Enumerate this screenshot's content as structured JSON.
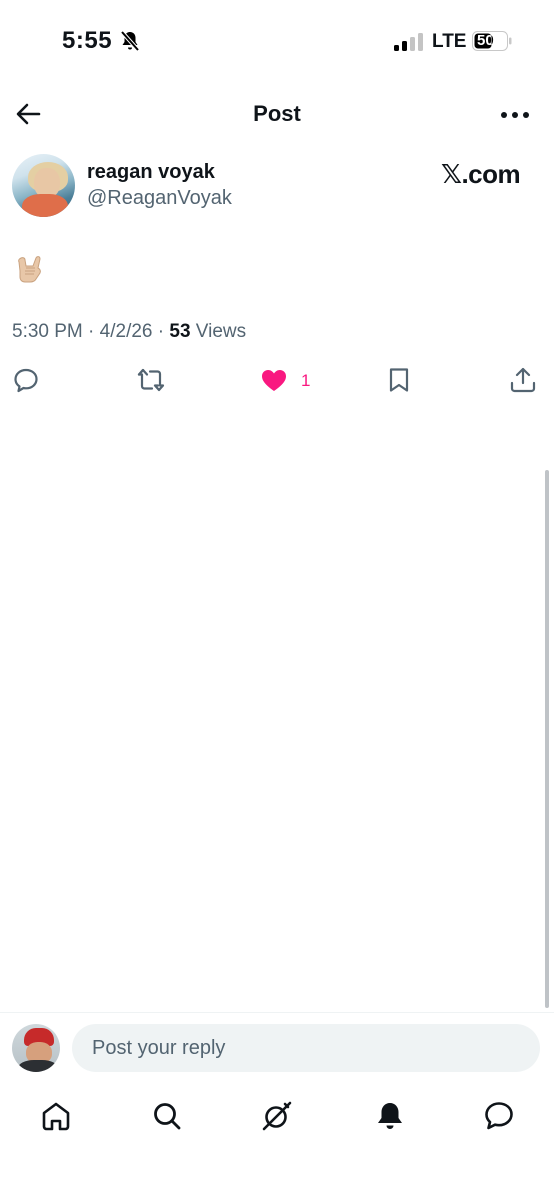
{
  "status_bar": {
    "time": "5:55",
    "network": "LTE",
    "battery": "50"
  },
  "header": {
    "title": "Post"
  },
  "post": {
    "author_name": "reagan voyak",
    "author_handle": "@ReaganVoyak",
    "source_label": "𝕏.com",
    "body_emoji": "🤙🏼",
    "time": "5:30 PM",
    "date": "4/2/26",
    "views_count": "53",
    "views_label": "Views",
    "likes_count": "1",
    "liked": true
  },
  "reply": {
    "placeholder": "Post your reply"
  },
  "colors": {
    "like": "#f91880",
    "secondary_text": "#536471",
    "primary_text": "#0f1419"
  },
  "icons": {
    "actions": [
      "reply-icon",
      "repost-icon",
      "heart-filled-icon",
      "bookmark-icon",
      "share-icon"
    ],
    "nav": [
      "home-icon",
      "search-icon",
      "grok-icon",
      "notifications-icon",
      "messages-icon"
    ]
  }
}
